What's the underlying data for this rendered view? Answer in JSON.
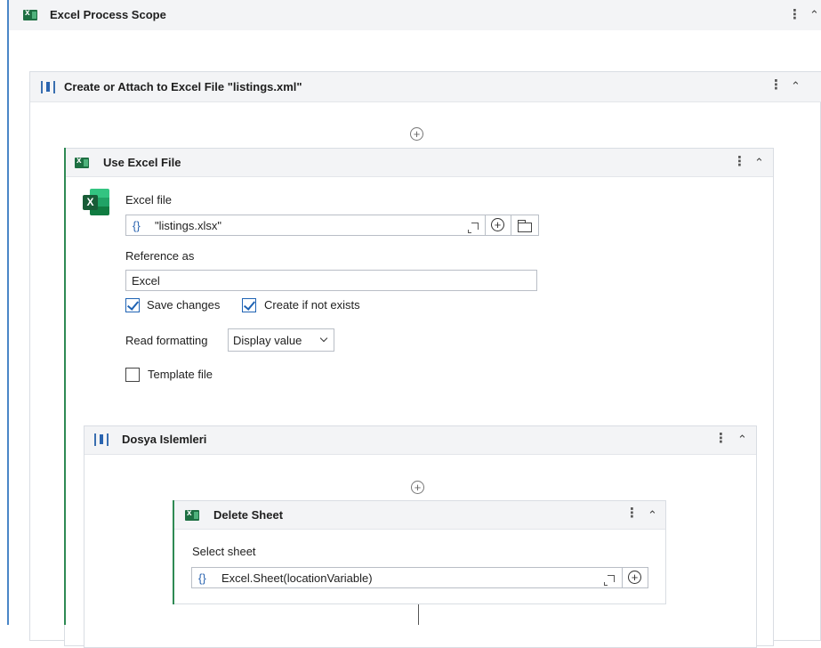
{
  "excel_process_scope": {
    "title": "Excel Process Scope"
  },
  "create_attach": {
    "title": "Create or Attach to Excel File \"listings.xml\""
  },
  "use_excel_file": {
    "title": "Use Excel File",
    "excel_file_label": "Excel file",
    "excel_file_braces": "{}",
    "excel_file_value": "\"listings.xlsx\"",
    "reference_as_label": "Reference as",
    "reference_as_value": "Excel",
    "save_changes_label": "Save changes",
    "save_changes_checked": true,
    "create_if_not_exists_label": "Create if not exists",
    "create_if_not_exists_checked": true,
    "read_formatting_label": "Read formatting",
    "read_formatting_value": "Display value",
    "template_file_label": "Template file",
    "template_file_checked": false,
    "icon_letter": "X"
  },
  "dosya_islemleri": {
    "title": "Dosya Islemleri"
  },
  "delete_sheet": {
    "title": "Delete Sheet",
    "select_sheet_label": "Select sheet",
    "select_sheet_braces": "{}",
    "select_sheet_value": "Excel.Sheet(locationVariable)"
  },
  "icons": {
    "more": "⋮",
    "collapse": "⌃",
    "add": "+"
  },
  "colors": {
    "accent_blue": "#4a86c7",
    "accent_green": "#2f8a54",
    "checkbox_blue": "#1f63b4"
  }
}
